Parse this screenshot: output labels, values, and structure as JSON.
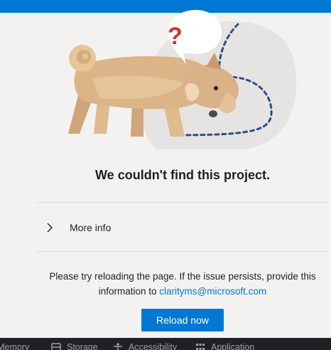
{
  "header": {
    "accent_color": "#0078d4"
  },
  "illustration": {
    "icon": "confused-dog-illustration",
    "bubble_glyph": "?"
  },
  "main": {
    "title": "We couldn't find this project.",
    "more_info_label": "More info",
    "message_text": "Please try reloading the page. If the issue persists, provide this information to",
    "support_email": "clarityms@microsoft.com",
    "reload_button_label": "Reload now"
  },
  "devtools": {
    "tabs": [
      {
        "label": "Memory",
        "icon": ""
      },
      {
        "label": "Storage",
        "icon": "storage-icon"
      },
      {
        "label": "Accessibility",
        "icon": "accessibility-icon"
      },
      {
        "label": "Application",
        "icon": "application-icon"
      }
    ]
  }
}
